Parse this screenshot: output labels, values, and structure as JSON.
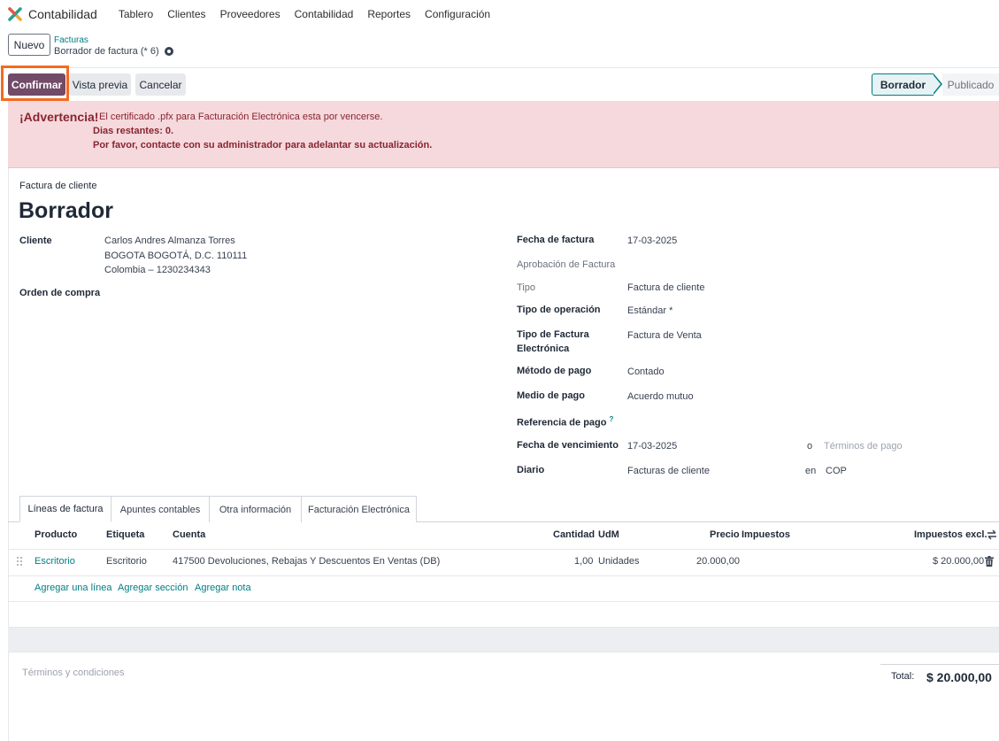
{
  "nav": {
    "app_name": "Contabilidad",
    "items": [
      "Tablero",
      "Clientes",
      "Proveedores",
      "Contabilidad",
      "Reportes",
      "Configuración"
    ]
  },
  "control": {
    "new_label": "Nuevo",
    "breadcrumb_parent": "Facturas",
    "breadcrumb_current": "Borrador de factura (* 6)"
  },
  "actions": {
    "confirm": "Confirmar",
    "preview": "Vista previa",
    "cancel": "Cancelar"
  },
  "status": {
    "active": "Borrador",
    "next": "Publicado"
  },
  "alert": {
    "title": "¡Advertencia!",
    "message": "El certificado .pfx para Facturación Electrónica esta por vencerse.",
    "days": "Dias restantes: 0.",
    "contact": "Por favor, contacte con su administrador para adelantar su actualización."
  },
  "doc": {
    "type": "Factura de cliente",
    "title": "Borrador"
  },
  "left": {
    "customer_label": "Cliente",
    "customer_name": "Carlos Andres Almanza Torres",
    "customer_addr1": "BOGOTA BOGOTÁ, D.C. 110111",
    "customer_addr2": "Colombia – 1230234343",
    "po_label": "Orden de compra"
  },
  "right": {
    "invoice_date_label": "Fecha de factura",
    "invoice_date": "17-03-2025",
    "approval_label": "Aprobación de Factura",
    "type_label": "Tipo",
    "type_value": "Factura de cliente",
    "operation_label": "Tipo de operación",
    "operation_value": "Estándar *",
    "einvoice_type_label_1": "Tipo de Factura",
    "einvoice_type_label_2": "Electrónica",
    "einvoice_type_value": "Factura de Venta",
    "payment_method_label": "Método de pago",
    "payment_method_value": "Contado",
    "payment_means_label": "Medio de pago",
    "payment_means_value": "Acuerdo mutuo",
    "payment_ref_label": "Referencia de pago",
    "payment_ref_hint": "?",
    "due_date_label": "Fecha de vencimiento",
    "due_date": "17-03-2025",
    "or": "o",
    "payment_terms_placeholder": "Términos de pago",
    "journal_label": "Diario",
    "journal_value": "Facturas de cliente",
    "in": "en",
    "currency": "COP"
  },
  "tabs": [
    "Líneas de factura",
    "Apuntes contables",
    "Otra información",
    "Facturación Electrónica"
  ],
  "table": {
    "headers": {
      "product": "Producto",
      "label": "Etiqueta",
      "account": "Cuenta",
      "qty": "Cantidad",
      "uom": "UdM",
      "price": "Precio",
      "taxes": "Impuestos",
      "subtotal": "Impuestos excl."
    },
    "row": {
      "product": "Escritorio",
      "label": "Escritorio",
      "account": "417500 Devoluciones, Rebajas Y Descuentos En Ventas (DB)",
      "qty": "1,00",
      "uom": "Unidades",
      "price": "20.000,00",
      "subtotal": "$ 20.000,00"
    },
    "add_line": "Agregar una línea",
    "add_section": "Agregar sección",
    "add_note": "Agregar nota"
  },
  "footer": {
    "terms_placeholder": "Términos y condiciones",
    "total_label": "Total:",
    "total_value": "$ 20.000,00"
  },
  "colors": {
    "brand": "#714b67",
    "link": "#017e84",
    "highlight": "#f26b21",
    "alert_bg": "#f5d9dc"
  }
}
